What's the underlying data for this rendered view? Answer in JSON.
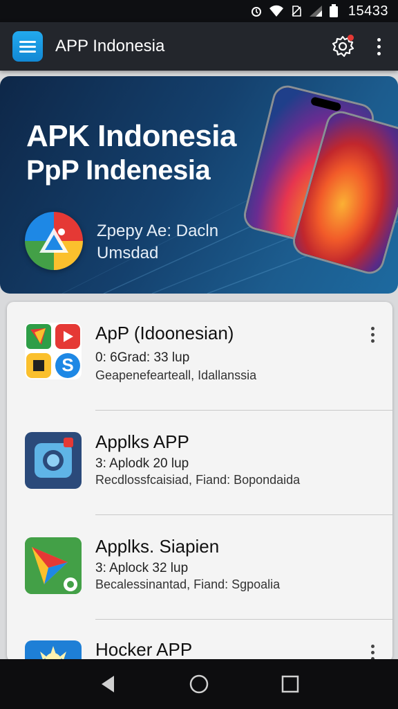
{
  "status_bar": {
    "time": "15433",
    "icons": [
      "alarm-icon",
      "wifi-icon",
      "signal-icon",
      "battery-icon"
    ]
  },
  "app_bar": {
    "title": "APP Indonesia",
    "menu_icon": "hamburger-icon",
    "settings_icon": "gear-icon",
    "overflow_icon": "more-vert-icon",
    "accent": "#1a9be6"
  },
  "banner": {
    "title_line1": "APK Indonesia",
    "title_line2": "PpP Indenesia",
    "subtitle_line1": "Zpepy Ae: Dacln",
    "subtitle_line2": "Umsdad"
  },
  "app_list": [
    {
      "title": "ApP (Idoonesian)",
      "meta": "0: 6Grad: 33 lup",
      "description": "Geapenefearteall, Idallanssia",
      "icon": "app-grid-icon"
    },
    {
      "title": "Applks APP",
      "meta": "3: Aplodk 20 lup",
      "description": "Recdlossfcaisiad, Fiand: Bopondaida",
      "icon": "camera-icon"
    },
    {
      "title": "Applks. Siapien",
      "meta": "3: Aplock 32 lup",
      "description": "Becalessinantad, Fiand: Sgpoalia",
      "icon": "play-store-icon"
    },
    {
      "title": "Hocker APP",
      "meta": "",
      "description": "",
      "icon": "sun-icon"
    }
  ],
  "nav_bar": {
    "back_icon": "back-icon",
    "home_icon": "home-icon",
    "recents_icon": "recents-icon"
  }
}
